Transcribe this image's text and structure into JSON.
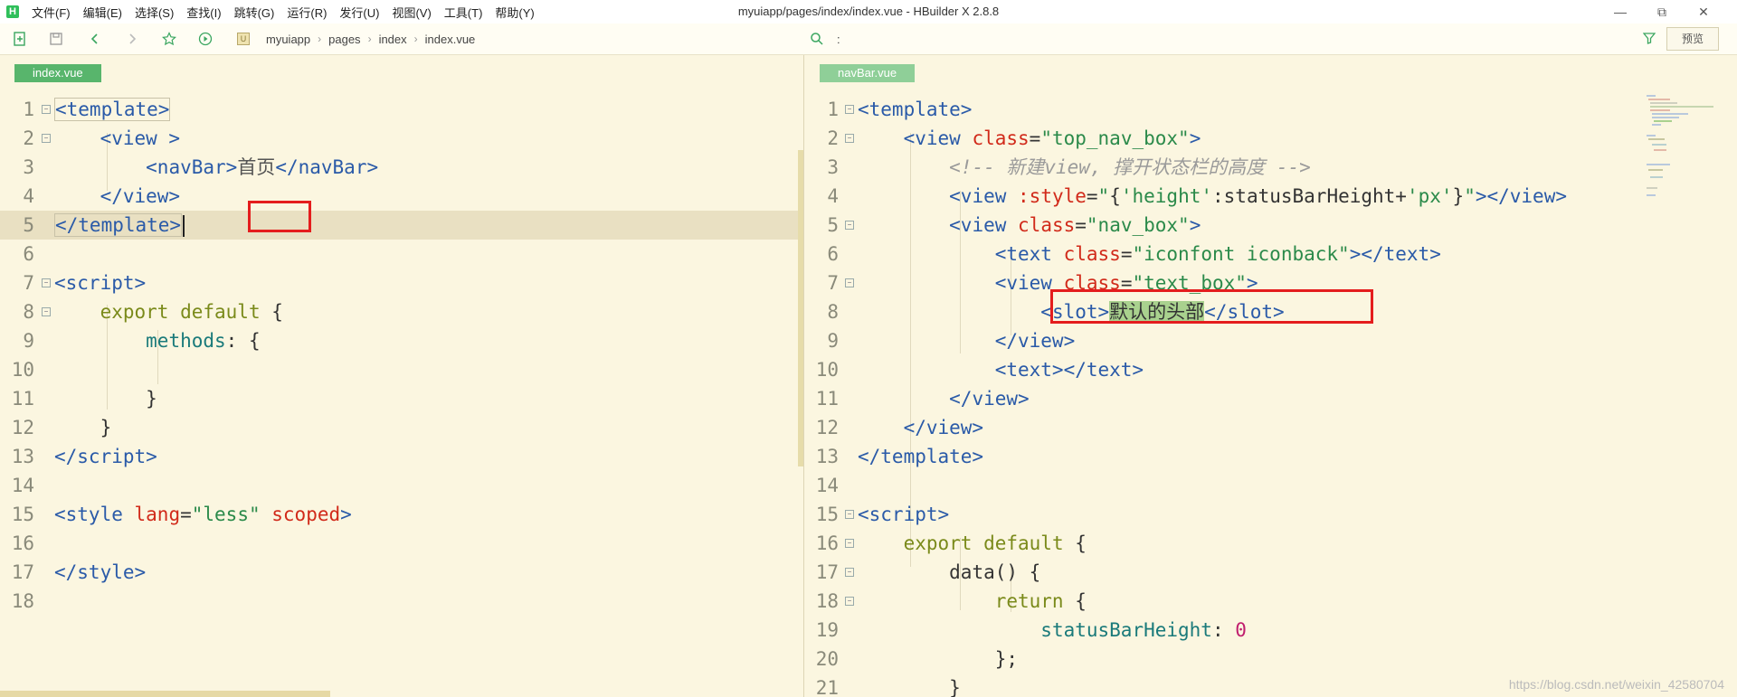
{
  "window": {
    "title": "myuiapp/pages/index/index.vue - HBuilder X 2.8.8",
    "logo_letter": "H",
    "minimize": "—",
    "maximize": "⧉",
    "close": "✕"
  },
  "menu": [
    "文件(F)",
    "编辑(E)",
    "选择(S)",
    "查找(I)",
    "跳转(G)",
    "运行(R)",
    "发行(U)",
    "视图(V)",
    "工具(T)",
    "帮助(Y)"
  ],
  "toolbar": {
    "breadcrumb": [
      "myuiapp",
      "pages",
      "index",
      "index.vue"
    ],
    "breadcrumb_badge": "U",
    "search_text": ":",
    "preview_label": "预览"
  },
  "left_editor": {
    "tab": "index.vue",
    "line_numbers": [
      "1",
      "2",
      "3",
      "4",
      "5",
      "6",
      "7",
      "8",
      "9",
      "10",
      "11",
      "12",
      "13",
      "14",
      "15",
      "16",
      "17",
      "18"
    ],
    "highlight_text": "首页"
  },
  "right_editor": {
    "tab": "navBar.vue",
    "line_numbers": [
      "1",
      "2",
      "3",
      "4",
      "5",
      "6",
      "7",
      "8",
      "9",
      "10",
      "11",
      "12",
      "13",
      "14",
      "15",
      "16",
      "17",
      "18",
      "19",
      "20",
      "21"
    ],
    "highlight_text": "默认的头部"
  },
  "watermark": "https://blog.csdn.net/weixin_42580704"
}
